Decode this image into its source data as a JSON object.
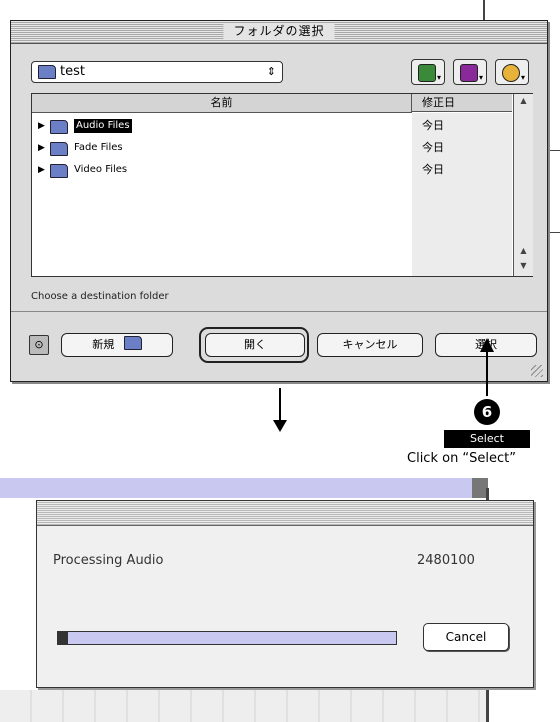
{
  "folder_dialog": {
    "title": "フォルダの選択",
    "location_popup": {
      "value": "test",
      "arrow": "⇕"
    },
    "toolbar_icons": [
      "desktop-icon",
      "file-icon",
      "recent-icon"
    ],
    "columns": {
      "name": "名前",
      "date": "修正日"
    },
    "rows": [
      {
        "name": "Audio Files",
        "date": "今日",
        "selected": true
      },
      {
        "name": "Fade Files",
        "date": "今日",
        "selected": false
      },
      {
        "name": "Video Files",
        "date": "今日",
        "selected": false
      }
    ],
    "status": "Choose a destination folder",
    "buttons": {
      "new_folder": "新規",
      "open": "開く",
      "cancel": "キャンセル",
      "select": "選択"
    }
  },
  "annotation": {
    "step_number": "6",
    "step_label": "Select",
    "instruction": "Click on “Select”"
  },
  "progress_dialog": {
    "label": "Processing Audio",
    "count": "2480100",
    "cancel_label": "Cancel",
    "progress": 0.03
  },
  "colors": {
    "progress_track": "#c8c8f0",
    "selection": "#000000"
  }
}
